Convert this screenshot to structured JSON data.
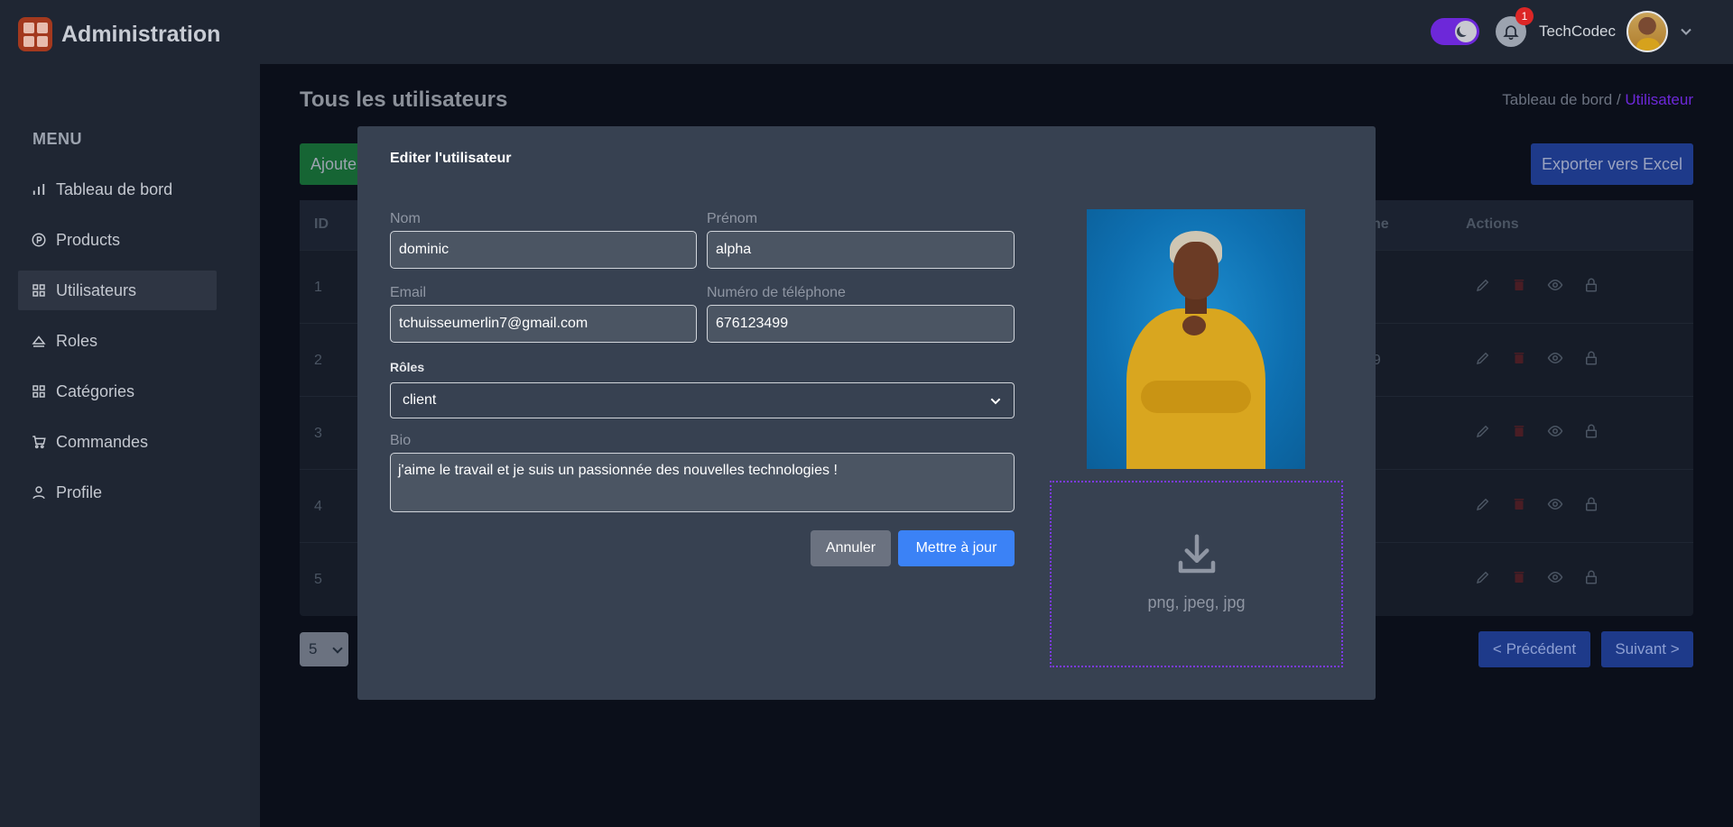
{
  "app": {
    "title": "Administration"
  },
  "topbar": {
    "notification_count": "1",
    "username": "TechCodec"
  },
  "sidebar": {
    "menu_title": "MENU",
    "items": [
      {
        "label": "Tableau de bord",
        "icon": "bar-chart-icon"
      },
      {
        "label": "Products",
        "icon": "product-icon"
      },
      {
        "label": "Utilisateurs",
        "icon": "users-icon",
        "active": true
      },
      {
        "label": "Roles",
        "icon": "roles-icon"
      },
      {
        "label": "Catégories",
        "icon": "categories-icon"
      },
      {
        "label": "Commandes",
        "icon": "cart-icon"
      },
      {
        "label": "Profile",
        "icon": "user-icon"
      }
    ]
  },
  "main": {
    "page_title": "Tous les utilisateurs",
    "breadcrumb": {
      "root": "Tableau de bord",
      "separator": " / ",
      "current": "Utilisateur"
    },
    "add_button": "Ajoute",
    "export_button": "Exporter vers Excel",
    "table": {
      "col_id": "ID",
      "col_phone_partial": "ne",
      "col_actions": "Actions",
      "rows": [
        {
          "id": "1",
          "phone_partial": ""
        },
        {
          "id": "2",
          "phone_partial": "99"
        },
        {
          "id": "3",
          "phone_partial": ""
        },
        {
          "id": "4",
          "phone_partial": ""
        },
        {
          "id": "5",
          "phone_partial": ""
        }
      ]
    },
    "page_size": "5",
    "prev_button": "< Précédent",
    "next_button": "Suivant >"
  },
  "modal": {
    "title": "Editer l'utilisateur",
    "nom_label": "Nom",
    "nom_value": "dominic",
    "prenom_label": "Prénom",
    "prenom_value": "alpha",
    "email_label": "Email",
    "email_value": "tchuisseumerlin7@gmail.com",
    "phone_label": "Numéro de téléphone",
    "phone_value": "676123499",
    "roles_label": "Rôles",
    "roles_value": "client",
    "bio_label": "Bio",
    "bio_value": "j'aime le travail et je suis un passionnée des nouvelles technologies !",
    "cancel_button": "Annuler",
    "update_button": "Mettre à jour",
    "dropzone_text": "png, jpeg, jpg"
  },
  "colors": {
    "accent": "#6d28d9",
    "primary": "#3b82f6",
    "danger": "#dc2626",
    "success": "#166534"
  }
}
